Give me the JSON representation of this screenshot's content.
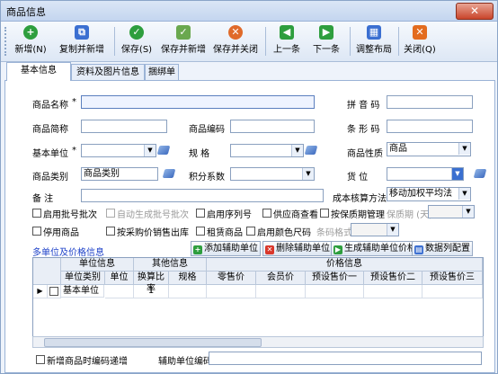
{
  "window": {
    "title": "商品信息",
    "close_icon": "close-x-icon"
  },
  "toolbar": [
    {
      "label": "新增(N)",
      "icon": "add-icon",
      "color": "#2e9e3e",
      "glyph": "+"
    },
    {
      "label": "复制并新增",
      "icon": "copy-add-icon",
      "color": "#3b6fd1",
      "glyph": "⧉"
    },
    {
      "label": "保存(S)",
      "icon": "save-check-icon",
      "color": "#2e9e3e",
      "glyph": "✓"
    },
    {
      "label": "保存并新增",
      "icon": "save-add-icon",
      "color": "#6aa84f",
      "glyph": "✓"
    },
    {
      "label": "保存并关闭",
      "icon": "save-close-icon",
      "color": "#e06a2a",
      "glyph": "✕"
    },
    {
      "label": "上一条",
      "icon": "prev-icon",
      "color": "#2e9e3e",
      "glyph": "◀"
    },
    {
      "label": "下一条",
      "icon": "next-icon",
      "color": "#2e9e3e",
      "glyph": "▶"
    },
    {
      "label": "调整布局",
      "icon": "layout-icon",
      "color": "#3b6fd1",
      "glyph": "▦"
    },
    {
      "label": "关闭(Q)",
      "icon": "close-icon",
      "color": "#e36c1f",
      "glyph": "✕"
    }
  ],
  "tabs": [
    "基本信息",
    "资料及图片信息",
    "捆绑单"
  ],
  "form": {
    "name_label": "商品名称",
    "pinyin_label": "拼 音 码",
    "short_label": "商品简称",
    "code_label": "商品编码",
    "barcode_label": "条 形 码",
    "unit_label": "基本单位",
    "spec_label": "规    格",
    "nature_label": "商品性质",
    "nature_value": "商品",
    "category_label": "商品类别",
    "category_value": "商品类别",
    "points_label": "积分系数",
    "location_label": "货    位",
    "note_label": "备    注",
    "cost_label": "成本核算方法",
    "cost_value": "移动加权平均法",
    "required_mark": "*"
  },
  "options": {
    "row1": [
      "启用批号批次",
      "自动生成批号批次",
      "启用序列号",
      "供应商查看",
      "按保质期管理"
    ],
    "shelf_label": "保质期 (天)",
    "row2": [
      "停用商品",
      "按采购价销售出库",
      "租赁商品",
      "启用颜色尺码"
    ],
    "barcode_fmt_label": "条码格式"
  },
  "section": {
    "link": "多单位及价格信息",
    "buttons": [
      {
        "label": "添加辅助单位",
        "icon": "add-unit-icon",
        "color": "#2e9e3e",
        "glyph": "+"
      },
      {
        "label": "删除辅助单位",
        "icon": "delete-unit-icon",
        "color": "#d9372b",
        "glyph": "✕"
      },
      {
        "label": "生成辅助单位价格",
        "icon": "generate-price-icon",
        "color": "#2e9e3e",
        "glyph": "▶"
      },
      {
        "label": "数据列配置",
        "icon": "column-config-icon",
        "color": "#3b6fd1",
        "glyph": "▤"
      }
    ]
  },
  "grid": {
    "groups": [
      "单位信息",
      "其他信息",
      "价格信息"
    ],
    "columns": [
      "单位类别",
      "单位",
      "换算比率",
      "规格",
      "零售价",
      "会员价",
      "预设售价一",
      "预设售价二",
      "预设售价三"
    ],
    "rows": [
      {
        "category": "基本单位",
        "unit": "",
        "ratio": "1",
        "spec": ""
      }
    ]
  },
  "footer": {
    "check_label": "新增商品时编码递增",
    "aux_label": "辅助单位编码"
  }
}
